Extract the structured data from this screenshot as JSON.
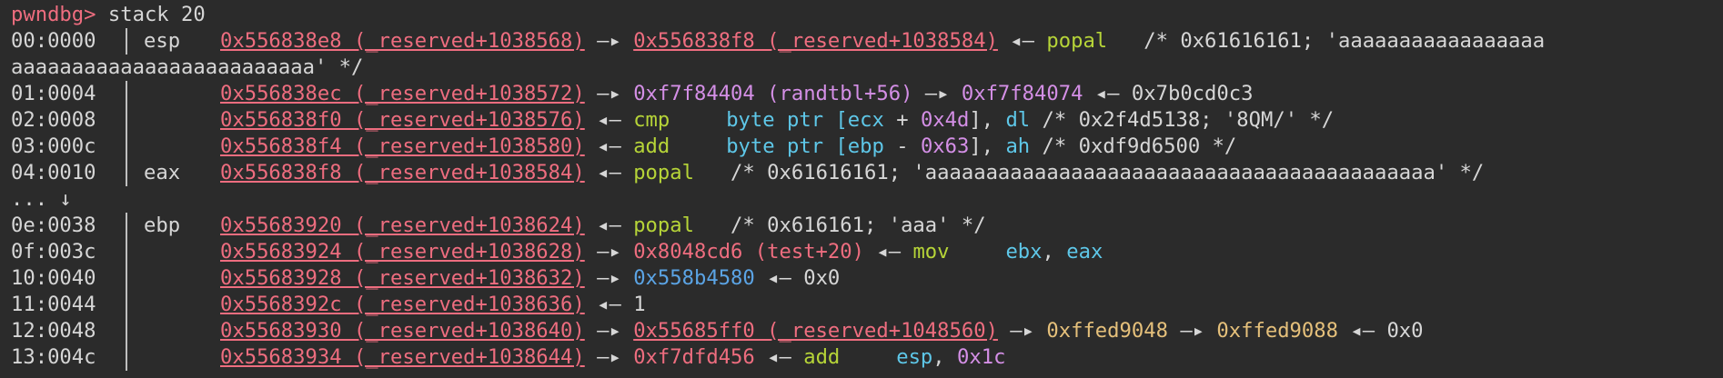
{
  "prompt": "pwndbg>",
  "command": " stack 20",
  "rows": [
    {
      "prefix": "00:0000",
      "reg": "esp",
      "addr": "0x556838e8 (_reserved+1038568)",
      "a1": " —▸ ",
      "t1": "0x556838f8 (_reserved+1038584)",
      "a2": " ◂— ",
      "ins": "popal",
      "cmt": "   /* 0x61616161; 'aaaaaaaaaaaaaaaaa"
    },
    {
      "cont": "aaaaaaaaaaaaaaaaaaaaaaaaa' */"
    },
    {
      "prefix": "01:0004",
      "addr": "0x556838ec (_reserved+1038572)",
      "a1": " —▸ ",
      "t1": "0xf7f84404 (randtbl+56)",
      "a2": " —▸ ",
      "t2": "0xf7f84074",
      "a3": " ◂— ",
      "val": "0x7b0cd0c3"
    },
    {
      "prefix": "02:0008",
      "addr": "0x556838f0 (_reserved+1038576)",
      "a1": " ◂— ",
      "ins": "cmp",
      "op1": "byte ptr [",
      "r1": "ecx",
      "op2": " + ",
      "n1": "0x4d",
      "op3": "], ",
      "r2": "dl",
      "cmt": " /* 0x2f4d5138; '8QM/' */"
    },
    {
      "prefix": "03:000c",
      "addr": "0x556838f4 (_reserved+1038580)",
      "a1": " ◂— ",
      "ins": "add",
      "op1": "byte ptr [",
      "r1": "ebp",
      "op2": " - ",
      "n1": "0x63",
      "op3": "], ",
      "r2": "ah",
      "cmt": " /* 0xdf9d6500 */"
    },
    {
      "prefix": "04:0010",
      "reg": "eax",
      "addr": "0x556838f8 (_reserved+1038584)",
      "a1": " ◂— ",
      "ins": "popal",
      "cmt": "   /* 0x61616161; 'aaaaaaaaaaaaaaaaaaaaaaaaaaaaaaaaaaaaaaaaaa' */"
    },
    {
      "cont": "... ↓"
    },
    {
      "prefix": "0e:0038",
      "reg": "ebp",
      "addr": "0x55683920 (_reserved+1038624)",
      "a1": " ◂— ",
      "ins": "popal",
      "cmt": "   /* 0x616161; 'aaa' */"
    },
    {
      "prefix": "0f:003c",
      "addr": "0x55683924 (_reserved+1038628)",
      "a1": " —▸ ",
      "t1": "0x8048cd6 (test+20)",
      "a2": " ◂— ",
      "ins": "mov",
      "r1": "ebx",
      "op2": ", ",
      "r2": "eax"
    },
    {
      "prefix": "10:0040",
      "addr": "0x55683928 (_reserved+1038632)",
      "a1": " —▸ ",
      "t1": "0x558b4580",
      "a2": " ◂— ",
      "val": "0x0"
    },
    {
      "prefix": "11:0044",
      "addr": "0x5568392c (_reserved+1038636)",
      "a1": " ◂— ",
      "val": "1"
    },
    {
      "prefix": "12:0048",
      "addr": "0x55683930 (_reserved+1038640)",
      "a1": " —▸ ",
      "t1": "0x55685ff0 (_reserved+1048560)",
      "a2": " —▸ ",
      "t2": "0xffed9048",
      "a3": " —▸ ",
      "t3": "0xffed9088",
      "a4": " ◂— ",
      "val": "0x0"
    },
    {
      "prefix": "13:004c",
      "addr": "0x55683934 (_reserved+1038644)",
      "a1": " —▸ ",
      "t1": "0xf7dfd456",
      "a2": " ◂— ",
      "ins": "add",
      "r1": "esp",
      "op2": ", ",
      "n1": "0x1c"
    }
  ]
}
